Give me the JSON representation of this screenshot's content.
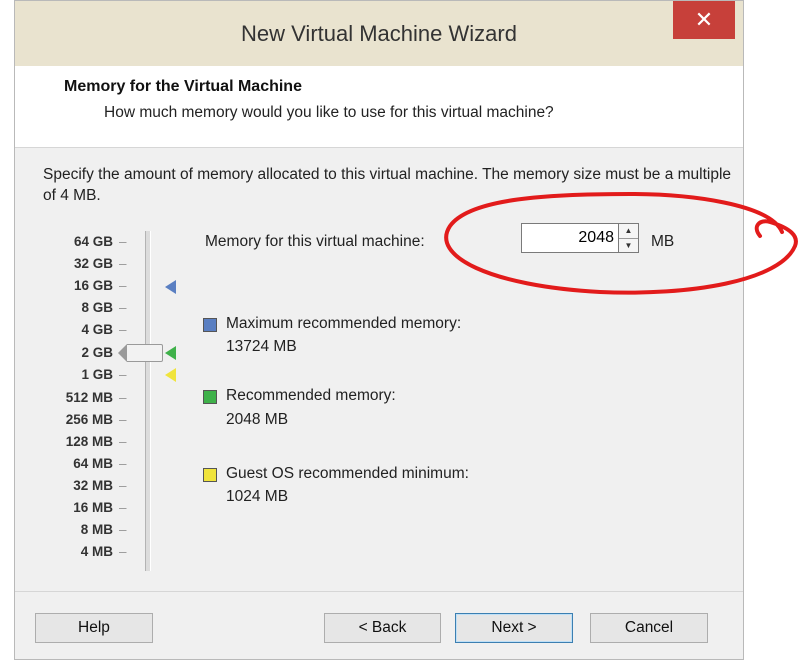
{
  "window": {
    "title": "New Virtual Machine Wizard",
    "close_icon": "close-icon"
  },
  "header": {
    "title": "Memory for the Virtual Machine",
    "subtitle": "How much memory would you like to use for this virtual machine?"
  },
  "description": "Specify the amount of memory allocated to this virtual machine. The memory size must be a multiple of 4 MB.",
  "scale_ticks": [
    "64 GB",
    "32 GB",
    "16 GB",
    "8 GB",
    "4 GB",
    "2 GB",
    "1 GB",
    "512 MB",
    "256 MB",
    "128 MB",
    "64 MB",
    "32 MB",
    "16 MB",
    "8 MB",
    "4 MB"
  ],
  "memory": {
    "label": "Memory for this virtual machine:",
    "value": "2048",
    "unit": "MB"
  },
  "legend": [
    {
      "label": "Maximum recommended memory:",
      "value": "13724 MB",
      "color": "#5a7fc2"
    },
    {
      "label": "Recommended memory:",
      "value": "2048 MB",
      "color": "#3fb14a"
    },
    {
      "label": "Guest OS recommended minimum:",
      "value": "1024 MB",
      "color": "#f0e43c"
    }
  ],
  "buttons": {
    "help": "Help",
    "back": "< Back",
    "next": "Next >",
    "cancel": "Cancel"
  },
  "annotation_color": "#e21b1b"
}
